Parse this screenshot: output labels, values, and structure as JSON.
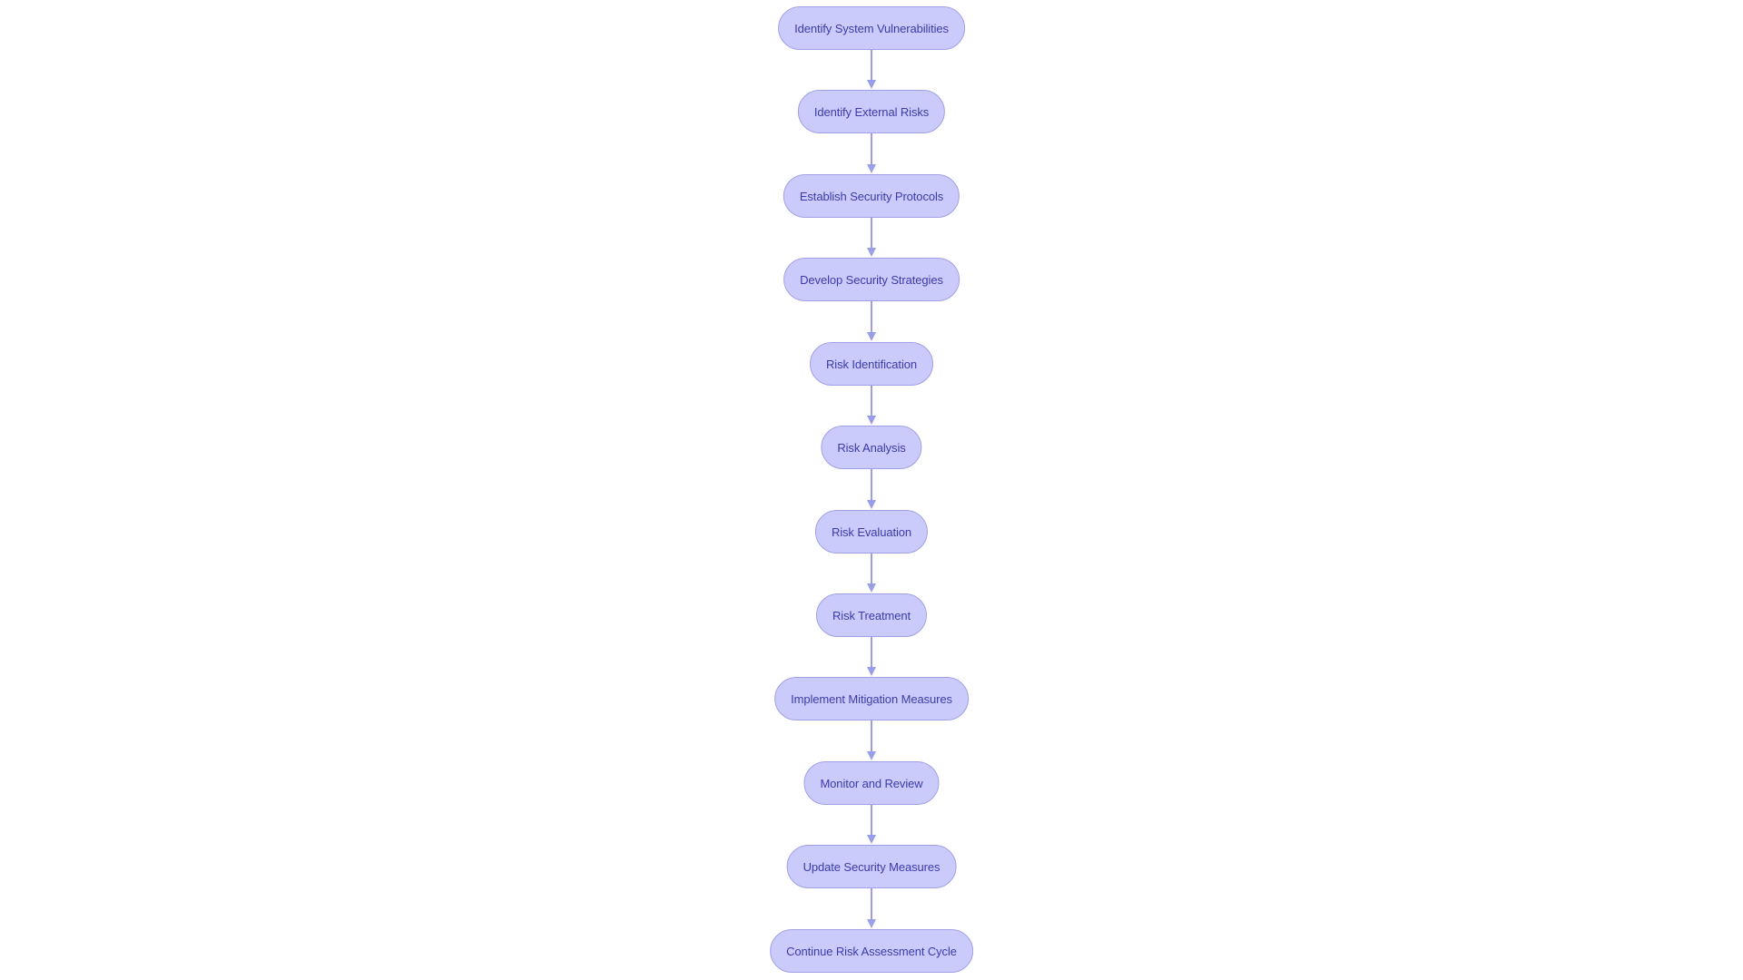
{
  "diagram": {
    "type": "flowchart",
    "direction": "top-to-bottom",
    "colors": {
      "node_fill": "#cbcbfb",
      "node_stroke": "#a0a0e6",
      "node_text": "#3b3baa",
      "edge": "#9a9de8"
    },
    "nodes": [
      {
        "id": "n1",
        "label": "Identify System Vulnerabilities"
      },
      {
        "id": "n2",
        "label": "Identify External Risks"
      },
      {
        "id": "n3",
        "label": "Establish Security Protocols"
      },
      {
        "id": "n4",
        "label": "Develop Security Strategies"
      },
      {
        "id": "n5",
        "label": "Risk Identification"
      },
      {
        "id": "n6",
        "label": "Risk Analysis"
      },
      {
        "id": "n7",
        "label": "Risk Evaluation"
      },
      {
        "id": "n8",
        "label": "Risk Treatment"
      },
      {
        "id": "n9",
        "label": "Implement Mitigation Measures"
      },
      {
        "id": "n10",
        "label": "Monitor and Review"
      },
      {
        "id": "n11",
        "label": "Update Security Measures"
      },
      {
        "id": "n12",
        "label": "Continue Risk Assessment Cycle"
      }
    ],
    "edges": [
      {
        "from": "n1",
        "to": "n2"
      },
      {
        "from": "n2",
        "to": "n3"
      },
      {
        "from": "n3",
        "to": "n4"
      },
      {
        "from": "n4",
        "to": "n5"
      },
      {
        "from": "n5",
        "to": "n6"
      },
      {
        "from": "n6",
        "to": "n7"
      },
      {
        "from": "n7",
        "to": "n8"
      },
      {
        "from": "n8",
        "to": "n9"
      },
      {
        "from": "n9",
        "to": "n10"
      },
      {
        "from": "n10",
        "to": "n11"
      },
      {
        "from": "n11",
        "to": "n12"
      }
    ]
  }
}
